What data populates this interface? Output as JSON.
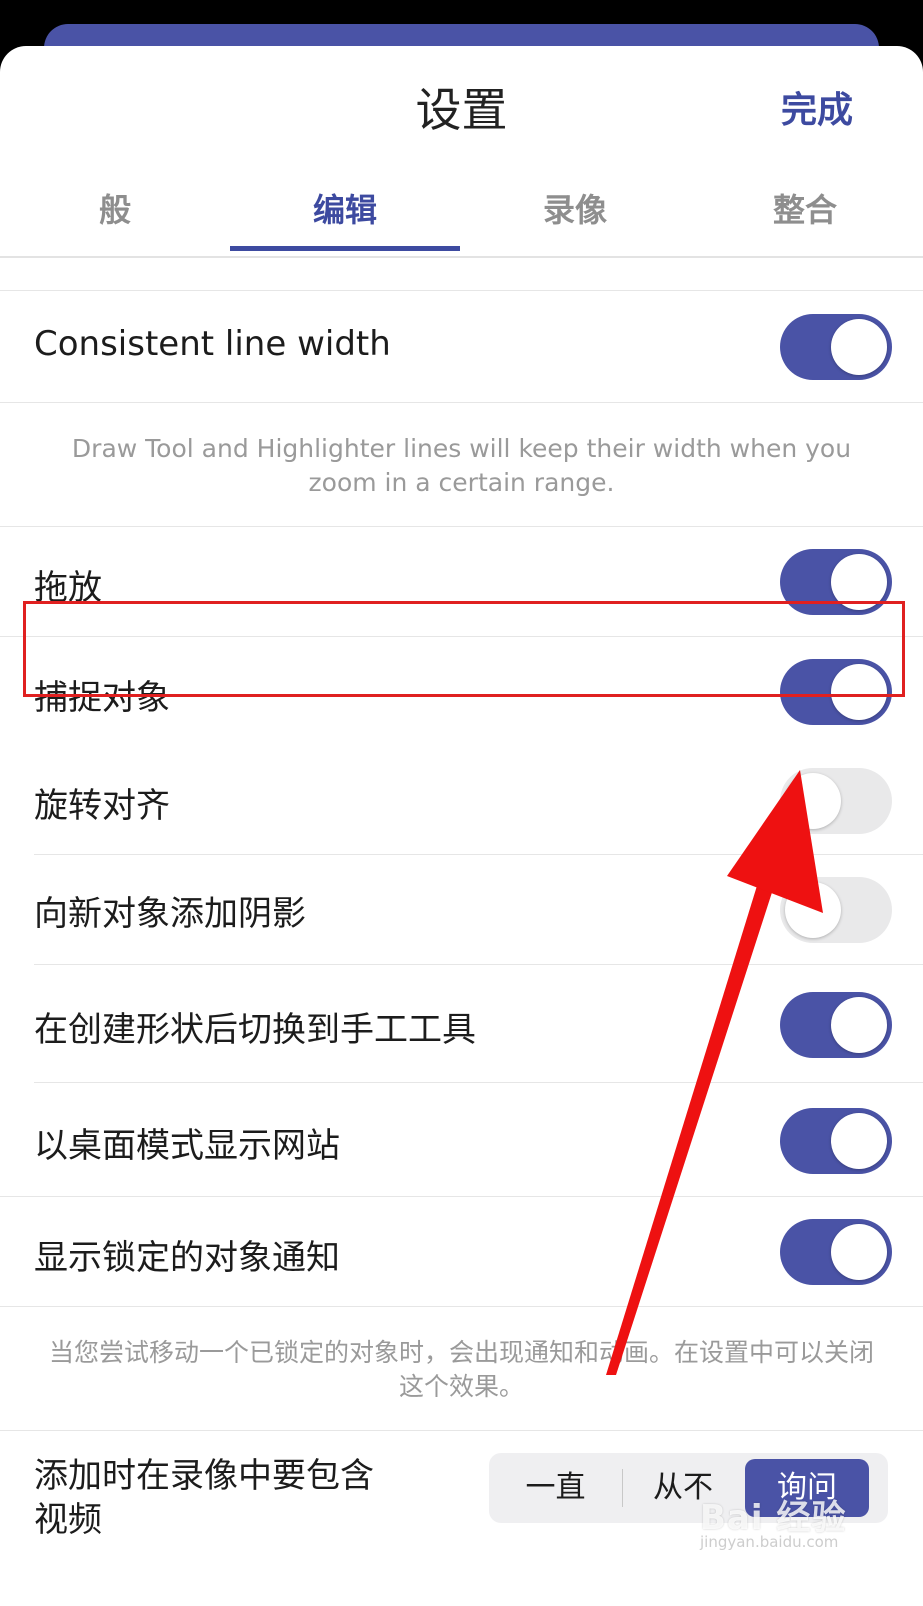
{
  "sheet": {
    "title": "设置",
    "done_label": "完成"
  },
  "tabs": [
    {
      "label": "般",
      "active": false
    },
    {
      "label": "编辑",
      "active": true
    },
    {
      "label": "录像",
      "active": false
    },
    {
      "label": "整合",
      "active": false
    }
  ],
  "settings": {
    "consistent_line_width": {
      "label": "Consistent line width",
      "on": true
    },
    "consistent_line_width_note": "Draw Tool and Highlighter lines will keep their width when you zoom in a certain range.",
    "drag_drop": {
      "label": "拖放",
      "on": true
    },
    "snap_objects": {
      "label": "捕捉对象",
      "on": true
    },
    "rotate_align": {
      "label": "旋转对齐",
      "on": false
    },
    "add_shadow": {
      "label": "向新对象添加阴影",
      "on": false
    },
    "switch_hand_tool": {
      "label": "在创建形状后切换到手工工具",
      "on": true
    },
    "desktop_mode": {
      "label": "以桌面模式显示网站",
      "on": true
    },
    "locked_notice": {
      "label": "显示锁定的对象通知",
      "on": true
    },
    "locked_notice_note": "当您尝试移动一个已锁定的对象时，会出现通知和动画。在设置中可以关闭这个效果。",
    "include_video": {
      "label_line1": "添加时在录像中要包含",
      "label_line2": "视频",
      "options": [
        "一直",
        "从不",
        "询问"
      ],
      "selected": "询问"
    }
  },
  "watermark": {
    "text": "Bai 经验",
    "sub": "jingyan.baidu.com"
  },
  "colors": {
    "accent": "#4a53a6",
    "tab_active": "#3d4aa0",
    "highlight_box": "#e02020",
    "arrow": "#ee1111"
  }
}
